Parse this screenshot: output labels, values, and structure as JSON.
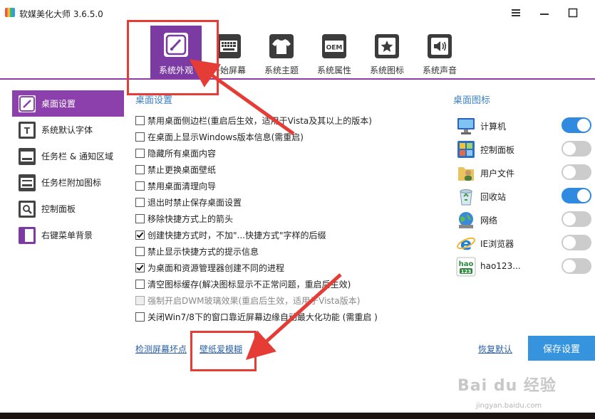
{
  "window": {
    "title": "软媒美化大师 3.6.5.0"
  },
  "toolbar": {
    "tabs": [
      {
        "label": "系统外观",
        "icon": "brush-icon",
        "active": true
      },
      {
        "label": "开始屏幕",
        "icon": "keyboard-icon",
        "active": false
      },
      {
        "label": "系统主题",
        "icon": "shirt-icon",
        "active": false
      },
      {
        "label": "系统属性",
        "icon": "oem-icon",
        "active": false,
        "icon_text": "OEM"
      },
      {
        "label": "系统图标",
        "icon": "star-icon",
        "active": false
      },
      {
        "label": "系统声音",
        "icon": "speaker-icon",
        "active": false
      }
    ]
  },
  "sidebar": {
    "items": [
      {
        "label": "桌面设置",
        "icon": "pencil-icon",
        "active": true
      },
      {
        "label": "系统默认字体",
        "icon": "font-icon"
      },
      {
        "label": "任务栏 & 通知区域",
        "icon": "taskbar-icon"
      },
      {
        "label": "任务栏附加图标",
        "icon": "taskbar-addon-icon"
      },
      {
        "label": "控制面板",
        "icon": "control-panel-icon"
      },
      {
        "label": "右键菜单背景",
        "icon": "context-menu-icon"
      }
    ]
  },
  "desktop_settings": {
    "title": "桌面设置",
    "options": [
      {
        "label": "禁用桌面侧边栏(重启后生效，适用于Vista及其以上的版本)",
        "checked": false
      },
      {
        "label": "在桌面上显示Windows版本信息(需重启)",
        "checked": false
      },
      {
        "label": "隐藏所有桌面内容",
        "checked": false
      },
      {
        "label": "禁止更换桌面壁纸",
        "checked": false
      },
      {
        "label": "禁用桌面清理向导",
        "checked": false
      },
      {
        "label": "退出时禁止保存桌面设置",
        "checked": false
      },
      {
        "label": "移除快捷方式上的箭头",
        "checked": false
      },
      {
        "label": "创建快捷方式时，不加\"...快捷方式\"字样的后缀",
        "checked": true
      },
      {
        "label": "禁止显示快捷方式的提示信息",
        "checked": false
      },
      {
        "label": "为桌面和资源管理器创建不同的进程",
        "checked": true
      },
      {
        "label": "清空图标缓存(解决图标显示不正常问题，重启后生效)",
        "checked": false
      },
      {
        "label": "强制开启DWM玻璃效果(重启后生效，适用于Vista版本)",
        "checked": false,
        "disabled": true
      },
      {
        "label": "关闭Win7/8下的窗口靠近屏幕边缘自动最大化功能 (需重启 )",
        "checked": false
      }
    ]
  },
  "desktop_icons": {
    "title": "桌面图标",
    "items": [
      {
        "label": "计算机",
        "icon": "computer-icon",
        "on": true
      },
      {
        "label": "控制面板",
        "icon": "control-panel-icon",
        "on": false
      },
      {
        "label": "用户文件",
        "icon": "user-folder-icon",
        "on": false
      },
      {
        "label": "回收站",
        "icon": "recycle-bin-icon",
        "on": true
      },
      {
        "label": "网络",
        "icon": "network-icon",
        "on": false
      },
      {
        "label": "IE浏览器",
        "icon": "ie-icon",
        "on": false
      },
      {
        "label": "hao123...",
        "icon": "hao123-icon",
        "on": false,
        "icon_text_top": "hao",
        "icon_text_bottom": "123"
      }
    ]
  },
  "footer": {
    "detect_link": "检测屏幕坏点",
    "wallpaper_link": "壁纸爱模糊",
    "restore_link": "恢复默认",
    "save_button": "保存设置"
  },
  "watermark": {
    "logo": "Bai du 经验",
    "url": "jingyan.baidu.com"
  },
  "colors": {
    "accent": "#7b3ba3",
    "toggle_on": "#2f8ae0",
    "save": "#3594dd",
    "link": "#2a5fa8",
    "annotation": "#e63c36"
  }
}
